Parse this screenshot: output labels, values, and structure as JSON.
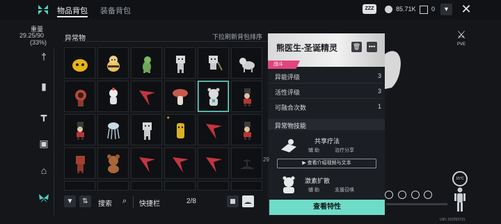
{
  "header": {
    "tabs": [
      {
        "label": "物品背包",
        "active": true
      },
      {
        "label": "装备背包",
        "active": false
      }
    ],
    "currency_badge": "ZZZ",
    "currency_1": "85.71K",
    "currency_2": "0",
    "dropdown_icon": "chevron-down-icon",
    "close_icon": "close-icon"
  },
  "sidebar": {
    "weight_label": "重量",
    "weight_value": "29.25/90",
    "weight_percent": "(33%)",
    "icons": [
      "weapon-icon",
      "canister-icon",
      "hammer-icon",
      "backpack-icon",
      "home-icon",
      "butterfly-icon"
    ]
  },
  "grid": {
    "title": "异常物",
    "sort_hint": "下拉刷新背包排序"
  },
  "toolbar": {
    "search_label": "搜索",
    "quick_label": "快捷栏",
    "quick_count": "2/8"
  },
  "detail": {
    "name": "熊医生-圣诞精灵",
    "badge": "战斗",
    "stats": [
      {
        "label": "异能评级",
        "value": "3"
      },
      {
        "label": "活性评级",
        "value": "3"
      },
      {
        "label": "可融合次数",
        "value": "1"
      }
    ],
    "skills_header": "异常物技能",
    "skills": [
      {
        "name": "共享疗法",
        "tags": [
          "辅 助",
          "治疗分享"
        ]
      },
      {
        "name": "激素扩散",
        "tags": [
          "辅 助",
          "支援召唤"
        ]
      }
    ],
    "video_button": "查看介绍视频与文本",
    "view_button": "查看特性"
  },
  "right": {
    "mode": "PVE",
    "temperature": "15°C",
    "uid": "UID: 152253721",
    "side_number": "29"
  },
  "colors": {
    "accent": "#6fdcc8",
    "badge": "#e0457d",
    "background": "#14161a"
  }
}
